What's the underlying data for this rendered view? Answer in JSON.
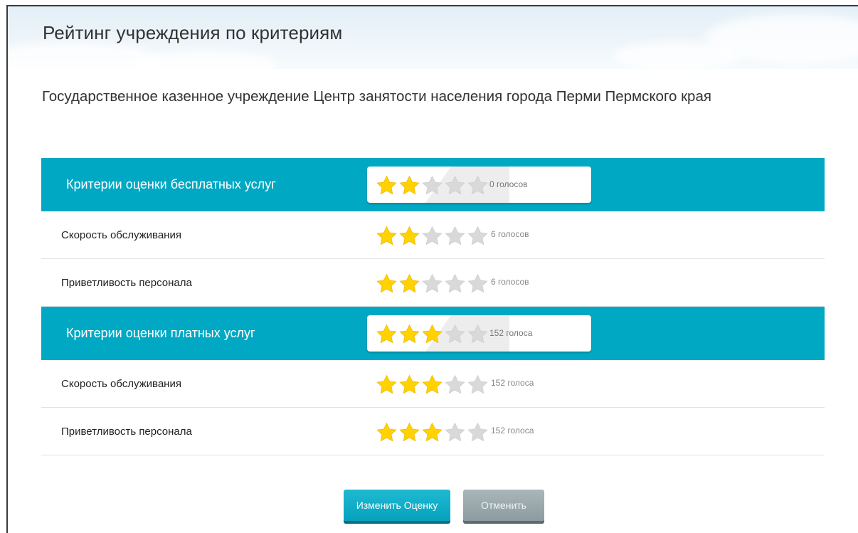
{
  "page": {
    "title": "Рейтинг учреждения по критериям",
    "organization": "Государственное казенное учреждение Центр занятости населения города Перми Пермского края"
  },
  "colors": {
    "accent": "#00a8c4",
    "star_filled": "#ffd200",
    "star_empty": "#d9d9d9"
  },
  "groups": [
    {
      "label": "Критерии оценки бесплатных услуг",
      "rating": 2,
      "max": 5,
      "votes": "0 голосов",
      "rows": [
        {
          "label": "Скорость обслуживания",
          "rating": 2,
          "max": 5,
          "votes": "6 голосов"
        },
        {
          "label": "Приветливость персонала",
          "rating": 2,
          "max": 5,
          "votes": "6 голосов"
        }
      ]
    },
    {
      "label": "Критерии оценки платных услуг",
      "rating": 3,
      "max": 5,
      "votes": "152 голоса",
      "rows": [
        {
          "label": "Скорость обслуживания",
          "rating": 3,
          "max": 5,
          "votes": "152 голоса"
        },
        {
          "label": "Приветливость персонала",
          "rating": 3,
          "max": 5,
          "votes": "152 голоса"
        }
      ]
    }
  ],
  "buttons": {
    "change": "Изменить Оценку",
    "cancel": "Отменить"
  }
}
